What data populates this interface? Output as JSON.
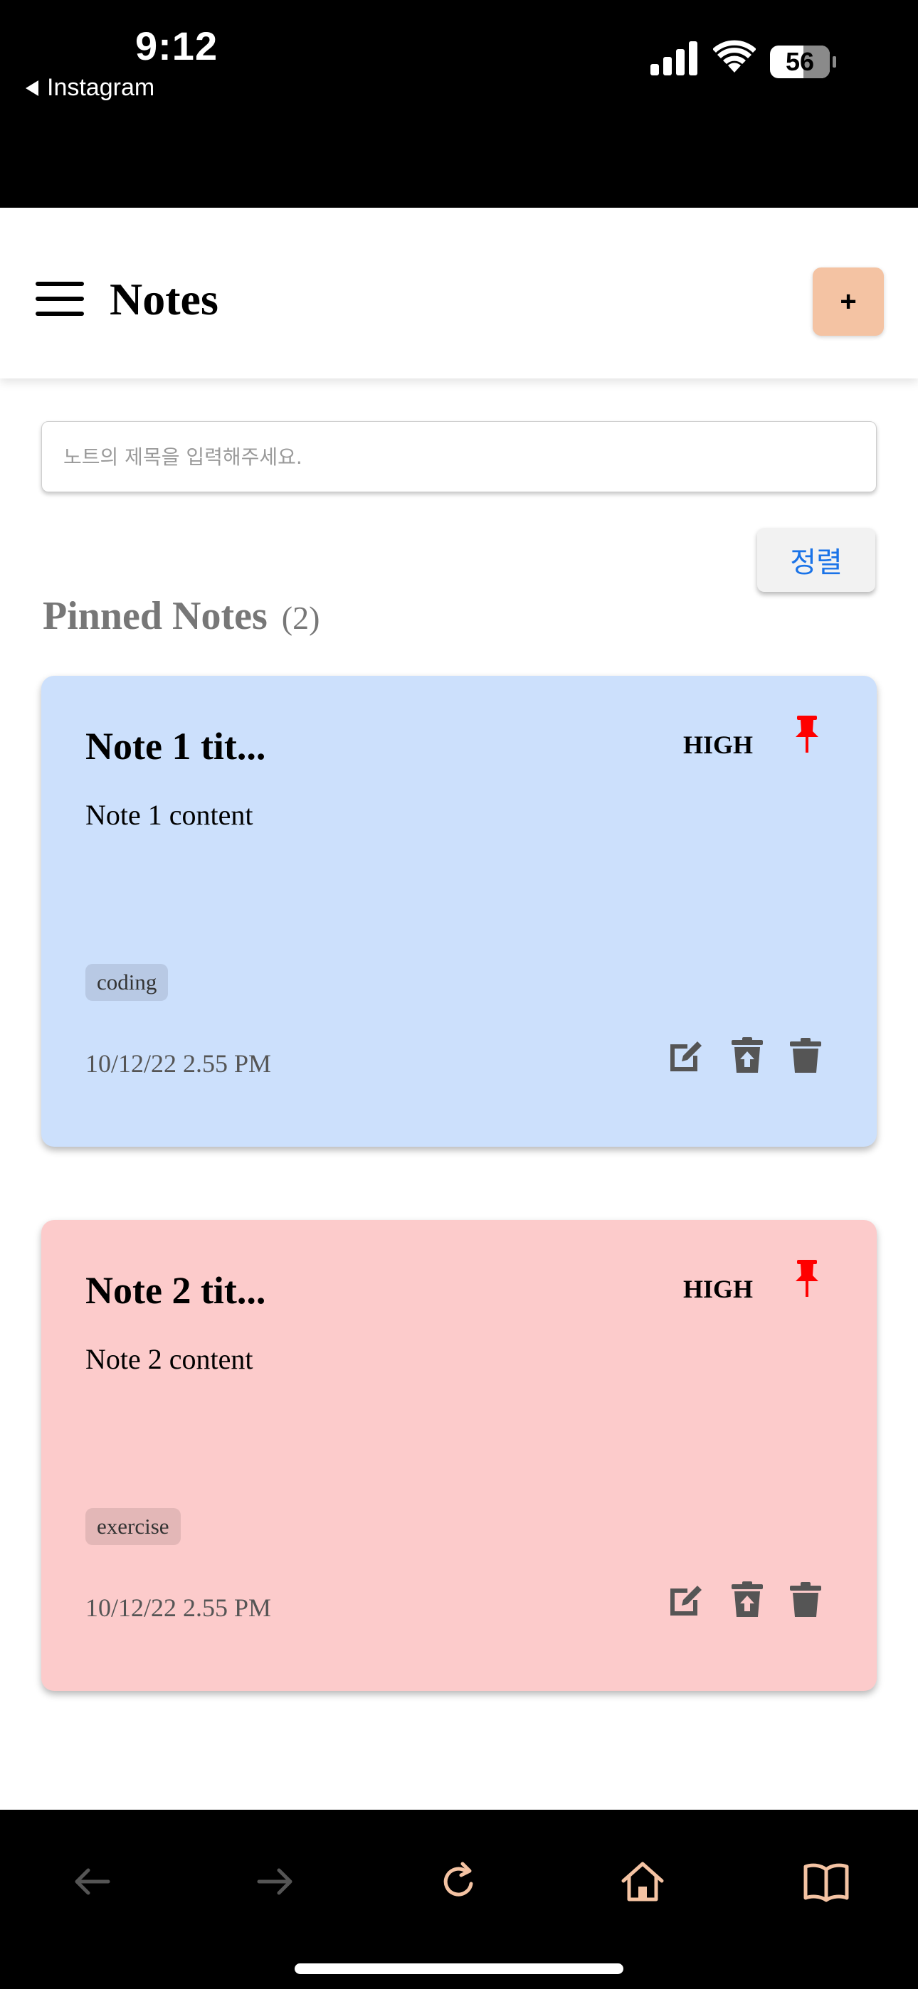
{
  "status_bar": {
    "time": "9:12",
    "back_app": "Instagram",
    "battery": "56"
  },
  "header": {
    "title": "Notes",
    "add_label": "+"
  },
  "search": {
    "placeholder": "노트의 제목을 입력해주세요.",
    "value": ""
  },
  "sort": {
    "label": "정렬"
  },
  "pinned": {
    "heading": "Pinned Notes",
    "count": "(2)"
  },
  "notes": [
    {
      "title": "Note 1 tit...",
      "priority": "HIGH",
      "content": "Note 1 content",
      "tag": "coding",
      "date": "10/12/22 2.55 PM",
      "background": "#cce0fc",
      "tag_background": "#b8c9e4"
    },
    {
      "title": "Note 2 tit...",
      "priority": "HIGH",
      "content": "Note 2 content",
      "tag": "exercise",
      "date": "10/12/22 2.55 PM",
      "background": "#fccbcb",
      "tag_background": "#e3b7b7"
    }
  ],
  "icons": {
    "menu": "hamburger-menu-icon",
    "pin": "pushpin-icon",
    "edit": "edit-icon",
    "archive": "archive-icon",
    "delete": "trash-icon",
    "toolbar": [
      "back-arrow-icon",
      "forward-arrow-icon",
      "reload-icon",
      "home-icon",
      "book-icon"
    ]
  },
  "colors": {
    "pin": "#ff0000",
    "accent_button": "#f4c3a3",
    "sort_text": "#1a73e8",
    "toolbar_icon_active": "#f4c3a3",
    "toolbar_icon_disabled": "#555555"
  }
}
